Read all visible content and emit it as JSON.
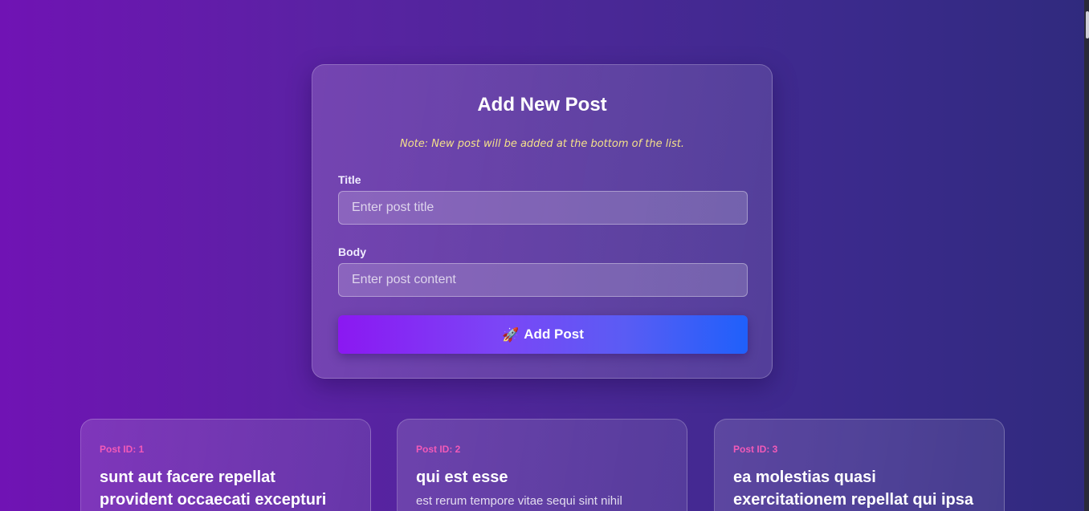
{
  "form": {
    "title": "Add New Post",
    "note": "Note: New post will be added at the bottom of the list.",
    "title_field": {
      "label": "Title",
      "placeholder": "Enter post title",
      "value": ""
    },
    "body_field": {
      "label": "Body",
      "placeholder": "Enter post content",
      "value": ""
    },
    "submit": {
      "icon": "rocket-icon",
      "icon_glyph": "🚀",
      "label": "Add Post"
    }
  },
  "posts": [
    {
      "id_label": "Post ID: 1",
      "title": "sunt aut facere repellat provident occaecati excepturi",
      "body": ""
    },
    {
      "id_label": "Post ID: 2",
      "title": "qui est esse",
      "body": "est rerum tempore vitae sequi sint nihil"
    },
    {
      "id_label": "Post ID: 3",
      "title": "ea molestias quasi exercitationem repellat qui ipsa",
      "body": ""
    }
  ],
  "colors": {
    "note": "#f4e08a",
    "post_id": "#f25ab8",
    "button_start": "#8b18f2",
    "button_end": "#1f60fb"
  }
}
